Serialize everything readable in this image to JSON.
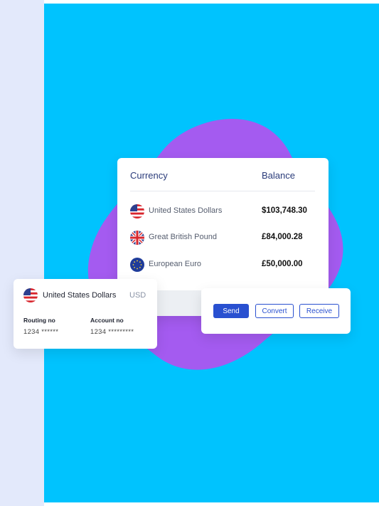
{
  "colors": {
    "background_strip": "#e3e9fb",
    "panel": "#00c3fe",
    "blob": "#a45bf0",
    "accent": "#2950d0"
  },
  "balance_card": {
    "currency_header": "Currency",
    "balance_header": "Balance",
    "rows": [
      {
        "flag": "us-flag-icon",
        "name": "United States Dollars",
        "amount": "$103,748.30"
      },
      {
        "flag": "uk-flag-icon",
        "name": "Great British Pound",
        "amount": "£84,000.28"
      },
      {
        "flag": "eu-flag-icon",
        "name": "European Euro",
        "amount": "£50,000.00"
      }
    ]
  },
  "account_card": {
    "flag": "us-flag-icon",
    "name": "United States Dollars",
    "code": "USD",
    "routing_label": "Routing no",
    "routing_value": "1234 ******",
    "account_label": "Account no",
    "account_value": "1234 *********"
  },
  "actions": {
    "send": "Send",
    "convert": "Convert",
    "receive": "Receive"
  }
}
